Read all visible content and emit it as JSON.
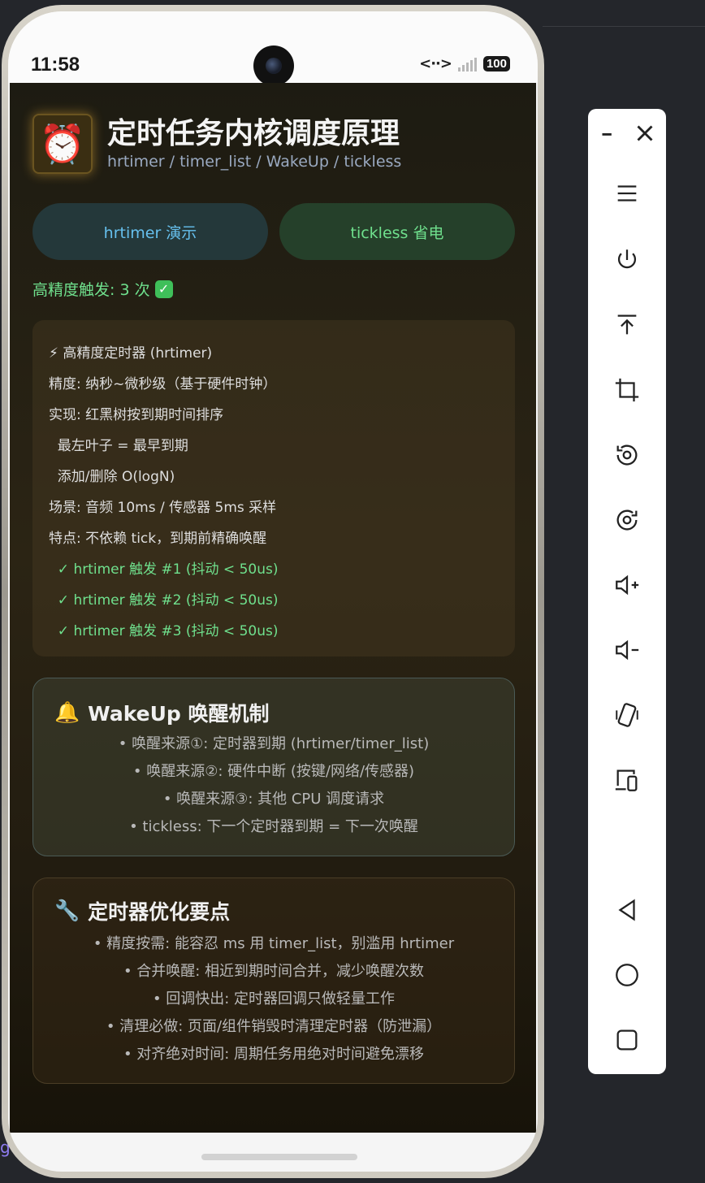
{
  "status_bar": {
    "time": "11:58",
    "network_label": "<··>",
    "battery": "100"
  },
  "app": {
    "icon": "alarm-clock-icon",
    "title": "定时任务内核调度原理",
    "subtitle": "hrtimer / timer_list / WakeUp / tickless"
  },
  "buttons": {
    "hrtimer_demo": "hrtimer 演示",
    "tickless_demo": "tickless 省电"
  },
  "trigger_status": "高精度触发: 3 次",
  "log": {
    "title": "⚡ 高精度定时器 (hrtimer)",
    "lines": [
      "精度: 纳秒~微秒级（基于硬件时钟）",
      "实现: 红黑树按到期时间排序",
      "  最左叶子 = 最早到期",
      "  添加/删除 O(logN)",
      "场景: 音频 10ms / 传感器 5ms 采样",
      "特点: 不依赖 tick，到期前精确唤醒"
    ],
    "results": [
      "  ✓ hrtimer 触发 #1 (抖动 < 50us)",
      "  ✓ hrtimer 触发 #2 (抖动 < 50us)",
      "  ✓ hrtimer 触发 #3 (抖动 < 50us)"
    ]
  },
  "wakeup_card": {
    "icon": "bell-icon",
    "title": "WakeUp 唤醒机制",
    "items": [
      "• 唤醒来源①: 定时器到期 (hrtimer/timer_list)",
      "• 唤醒来源②: 硬件中断 (按键/网络/传感器)",
      "• 唤醒来源③: 其他 CPU 调度请求",
      "• tickless: 下一个定时器到期 = 下一次唤醒"
    ]
  },
  "optimize_card": {
    "icon": "wrench-icon",
    "title": "定时器优化要点",
    "items": [
      "• 精度按需: 能容忍 ms 用 timer_list，别滥用 hrtimer",
      "• 合并唤醒: 相近到期时间合并，减少唤醒次数",
      "• 回调快出: 定时器回调只做轻量工作",
      "• 清理必做: 页面/组件销毁时清理定时器（防泄漏）",
      "• 对齐绝对时间: 周期任务用绝对时间避免漂移"
    ]
  },
  "left_stub_text": "g",
  "colors": {
    "accent_blue": "#66c0ee",
    "accent_green": "#6fe08d",
    "background": "#1d1b12"
  },
  "toolbar": [
    "minimize-icon",
    "close-icon",
    "menu-icon",
    "power-icon",
    "top-icon",
    "crop-icon",
    "rotate-left-icon",
    "rotate-right-icon",
    "volume-up-icon",
    "volume-down-icon",
    "shake-icon",
    "screen-mirror-icon",
    "back-icon",
    "home-icon",
    "overview-icon"
  ]
}
